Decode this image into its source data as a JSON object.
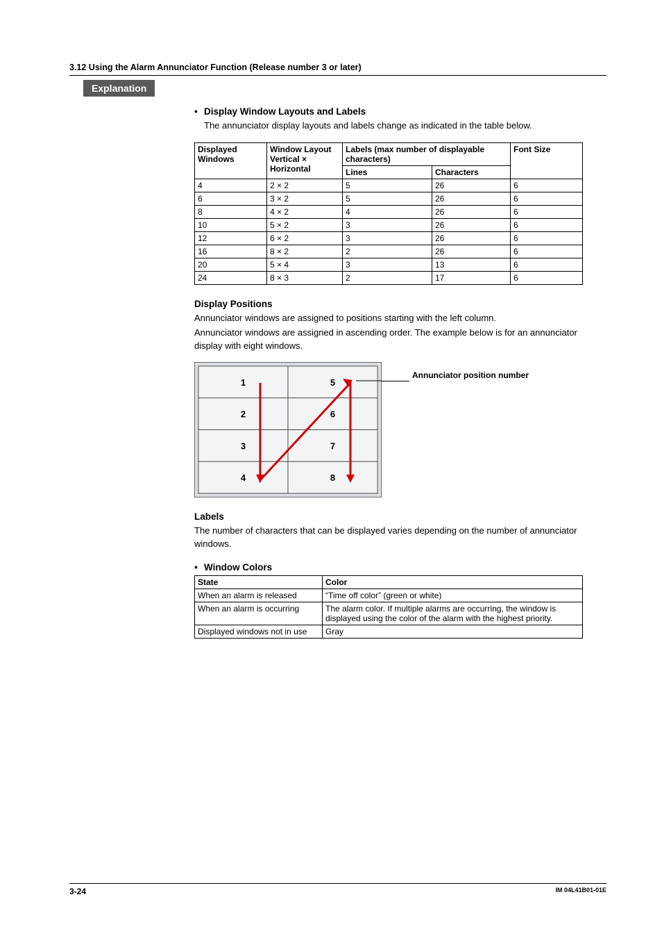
{
  "header": {
    "section": "3.12  Using the Alarm Annunciator Function (Release number 3 or later)"
  },
  "badge": "Explanation",
  "sec1": {
    "title": "Display Window Layouts and Labels",
    "intro": "The annunciator display layouts and labels change as indicated in the table below.",
    "table": {
      "h_disp": "Displayed Windows",
      "h_layout": "Window Layout Vertical × Horizontal",
      "h_labels": "Labels (max number of displayable characters)",
      "h_lines": "Lines",
      "h_chars": "Characters",
      "h_font": "Font Size",
      "rows": [
        {
          "disp": "4",
          "layout": "2 × 2",
          "lines": "5",
          "chars": "26",
          "font": "6"
        },
        {
          "disp": "6",
          "layout": "3 × 2",
          "lines": "5",
          "chars": "26",
          "font": "6"
        },
        {
          "disp": "8",
          "layout": "4 × 2",
          "lines": "4",
          "chars": "26",
          "font": "6"
        },
        {
          "disp": "10",
          "layout": "5 × 2",
          "lines": "3",
          "chars": "26",
          "font": "6"
        },
        {
          "disp": "12",
          "layout": "6 × 2",
          "lines": "3",
          "chars": "26",
          "font": "6"
        },
        {
          "disp": "16",
          "layout": "8 × 2",
          "lines": "2",
          "chars": "26",
          "font": "6"
        },
        {
          "disp": "20",
          "layout": "5 × 4",
          "lines": "3",
          "chars": "13",
          "font": "6"
        },
        {
          "disp": "24",
          "layout": "8 × 3",
          "lines": "2",
          "chars": "17",
          "font": "6"
        }
      ]
    }
  },
  "sec2": {
    "title": "Display Positions",
    "p1": "Annunciator windows are assigned to positions starting with the left column.",
    "p2": "Annunciator windows are assigned in ascending order. The example below is for an annunciator display with eight windows.",
    "callout": "Annunciator position number",
    "grid": [
      "1",
      "2",
      "3",
      "4",
      "5",
      "6",
      "7",
      "8"
    ]
  },
  "sec3": {
    "title": "Labels",
    "p": "The number of characters that can be displayed varies depending on the number of annunciator windows."
  },
  "sec4": {
    "title": "Window Colors",
    "table": {
      "h_state": "State",
      "h_color": "Color",
      "rows": [
        {
          "state": "When an alarm is released",
          "color": "“Time off color” (green or white)"
        },
        {
          "state": "When an alarm is occurring",
          "color": "The alarm color. If multiple alarms are occurring, the window is displayed using the color of the alarm with the highest priority."
        },
        {
          "state": "Displayed windows not in use",
          "color": "Gray"
        }
      ]
    }
  },
  "footer": {
    "page": "3-24",
    "doc": "IM 04L41B01-01E"
  }
}
